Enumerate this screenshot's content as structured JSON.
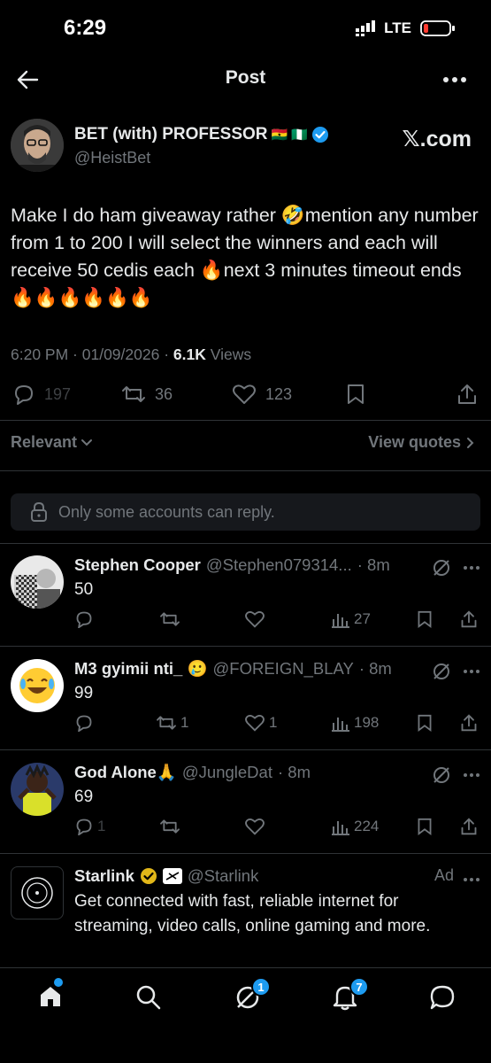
{
  "status_bar": {
    "time": "6:29",
    "network": "LTE"
  },
  "header": {
    "title": "Post"
  },
  "post": {
    "author_name": "BET (with) PROFESSOR",
    "author_flags": "🇬🇭 🇳🇬",
    "author_handle": "@HeistBet",
    "watermark": "𝕏.com",
    "text": "Make I do ham giveaway rather 🤣mention any number from 1 to 200 I will select the winners and each will receive 50 cedis each 🔥next 3 minutes timeout ends 🔥🔥🔥🔥🔥🔥",
    "time": "6:20 PM",
    "date": "01/09/2026",
    "views_count": "6.1K",
    "views_label": "Views",
    "replies": "197",
    "reposts": "36",
    "likes": "123"
  },
  "filter": {
    "sort_label": "Relevant",
    "quotes_label": "View quotes"
  },
  "reply_restriction": "Only some accounts can reply.",
  "replies": [
    {
      "name": "Stephen Cooper",
      "handle": "@Stephen079314...",
      "time": "8m",
      "text": "50",
      "replies": "",
      "reposts": "",
      "likes": "",
      "views": "27"
    },
    {
      "name": "M3 gyimii nti_ 🥲",
      "handle": "@FOREIGN_BLAY",
      "time": "8m",
      "text": "99",
      "replies": "",
      "reposts": "1",
      "likes": "1",
      "views": "198"
    },
    {
      "name": "God Alone🙏",
      "handle": "@JungleDat",
      "time": "8m",
      "text": "69",
      "replies": "1",
      "reposts": "",
      "likes": "",
      "views": "224"
    }
  ],
  "ad": {
    "name": "Starlink",
    "handle": "@Starlink",
    "label": "Ad",
    "text": "Get connected with fast, reliable internet for streaming, video calls, online gaming and more."
  },
  "nav": {
    "messages_badge": "1",
    "notifications_badge": "7"
  },
  "colors": {
    "background": "#000000",
    "accent": "#1d9bf0",
    "muted": "#71767b",
    "divider": "#2f3336",
    "like_red": "#f91880"
  }
}
